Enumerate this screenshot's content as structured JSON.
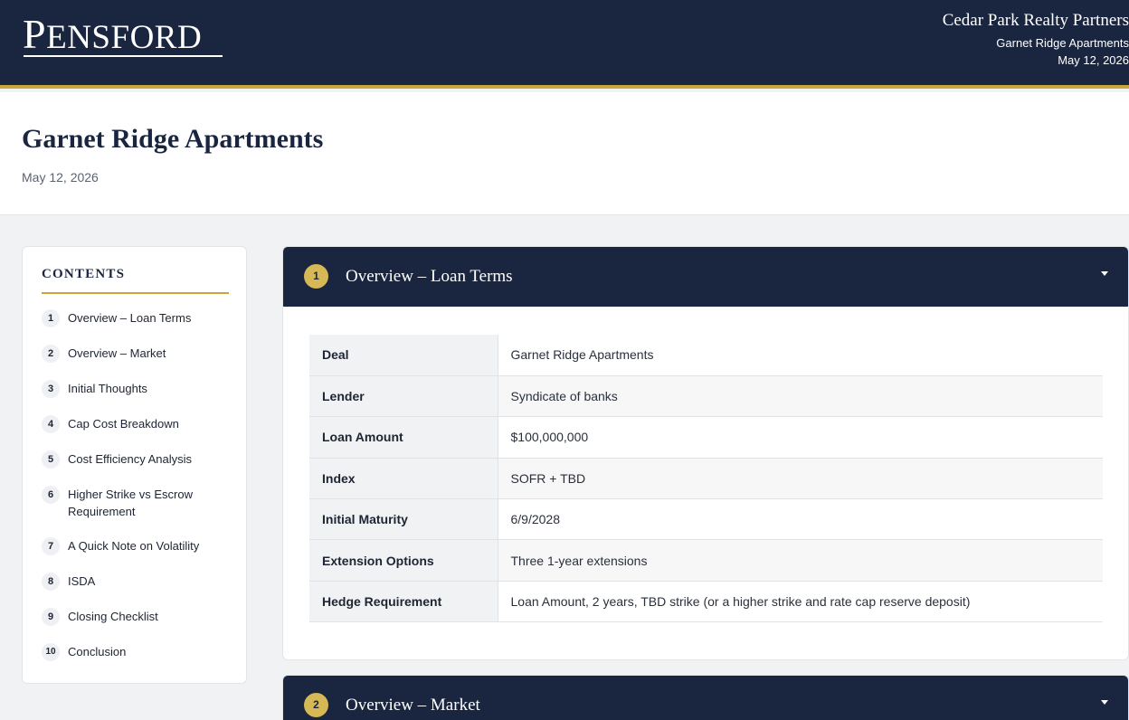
{
  "header": {
    "logo_first": "P",
    "logo_rest": "ENSFORD",
    "company": "Cedar Park Realty Partners",
    "project": "Garnet Ridge Apartments",
    "date": "May 12, 2026"
  },
  "page": {
    "title": "Garnet Ridge Apartments",
    "date": "May 12, 2026"
  },
  "toc": {
    "heading": "CONTENTS",
    "items": [
      {
        "num": "1",
        "label": "Overview – Loan Terms"
      },
      {
        "num": "2",
        "label": "Overview – Market"
      },
      {
        "num": "3",
        "label": "Initial Thoughts"
      },
      {
        "num": "4",
        "label": "Cap Cost Breakdown"
      },
      {
        "num": "5",
        "label": "Cost Efficiency Analysis"
      },
      {
        "num": "6",
        "label": "Higher Strike vs Escrow Requirement"
      },
      {
        "num": "7",
        "label": "A Quick Note on Volatility"
      },
      {
        "num": "8",
        "label": "ISDA"
      },
      {
        "num": "9",
        "label": "Closing Checklist"
      },
      {
        "num": "10",
        "label": "Conclusion"
      }
    ]
  },
  "sections": [
    {
      "num": "1",
      "title": "Overview – Loan Terms",
      "rows": [
        {
          "key": "Deal",
          "value": "Garnet Ridge Apartments"
        },
        {
          "key": "Lender",
          "value": "Syndicate of banks"
        },
        {
          "key": "Loan Amount",
          "value": "$100,000,000"
        },
        {
          "key": "Index",
          "value": "SOFR + TBD"
        },
        {
          "key": "Initial Maturity",
          "value": "6/9/2028"
        },
        {
          "key": "Extension Options",
          "value": "Three 1-year extensions"
        },
        {
          "key": "Hedge Requirement",
          "value": "Loan Amount, 2 years, TBD strike (or a higher strike and rate cap reserve deposit)"
        }
      ]
    },
    {
      "num": "2",
      "title": "Overview – Market"
    }
  ],
  "colors": {
    "navy": "#1a2640",
    "gold": "#c9a63a",
    "badge_gold": "#d7b856"
  },
  "icons": {
    "section_toggle": "caret-down-icon"
  }
}
